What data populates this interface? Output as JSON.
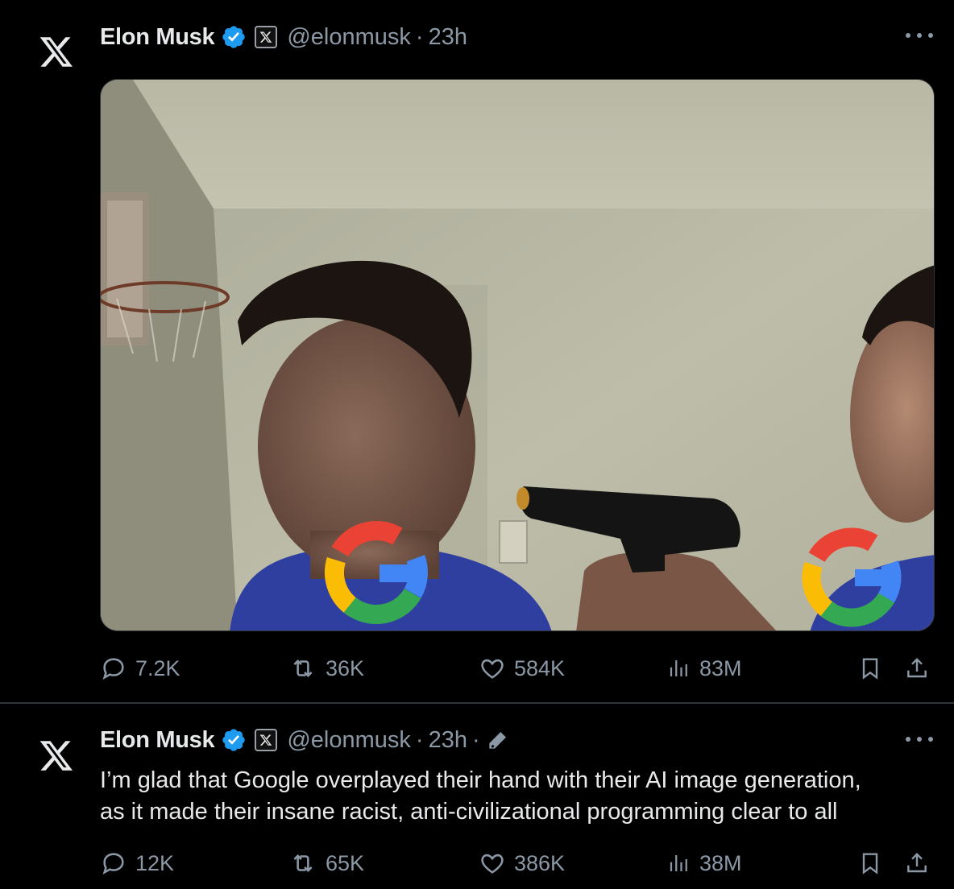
{
  "tweets": [
    {
      "author": {
        "name": "Elon Musk",
        "handle": "@elonmusk"
      },
      "separator": "·",
      "time": "23h",
      "media": {
        "badge": "G"
      },
      "stats": {
        "replies": "7.2K",
        "reposts": "36K",
        "likes": "584K",
        "views": "83M"
      }
    },
    {
      "author": {
        "name": "Elon Musk",
        "handle": "@elonmusk"
      },
      "separator": "·",
      "time": "23h",
      "edited_separator": "·",
      "text_lines": [
        "I’m glad that Google overplayed their hand with their AI image generation,",
        "as it made their insane racist, anti-civilizational programming clear to all"
      ],
      "stats": {
        "replies": "12K",
        "reposts": "65K",
        "likes": "386K",
        "views": "38M"
      }
    }
  ],
  "icons": [
    "x-logo-icon",
    "verified-badge-icon",
    "x-affiliate-badge-icon",
    "more-icon",
    "reply-icon",
    "repost-icon",
    "like-icon",
    "views-icon",
    "bookmark-icon",
    "share-icon",
    "edit-icon"
  ],
  "colors": {
    "background": "#000000",
    "text": "#e7e9ea",
    "muted": "#8b98a5",
    "verified": "#1d9bf0",
    "divider": "#2f3336"
  }
}
